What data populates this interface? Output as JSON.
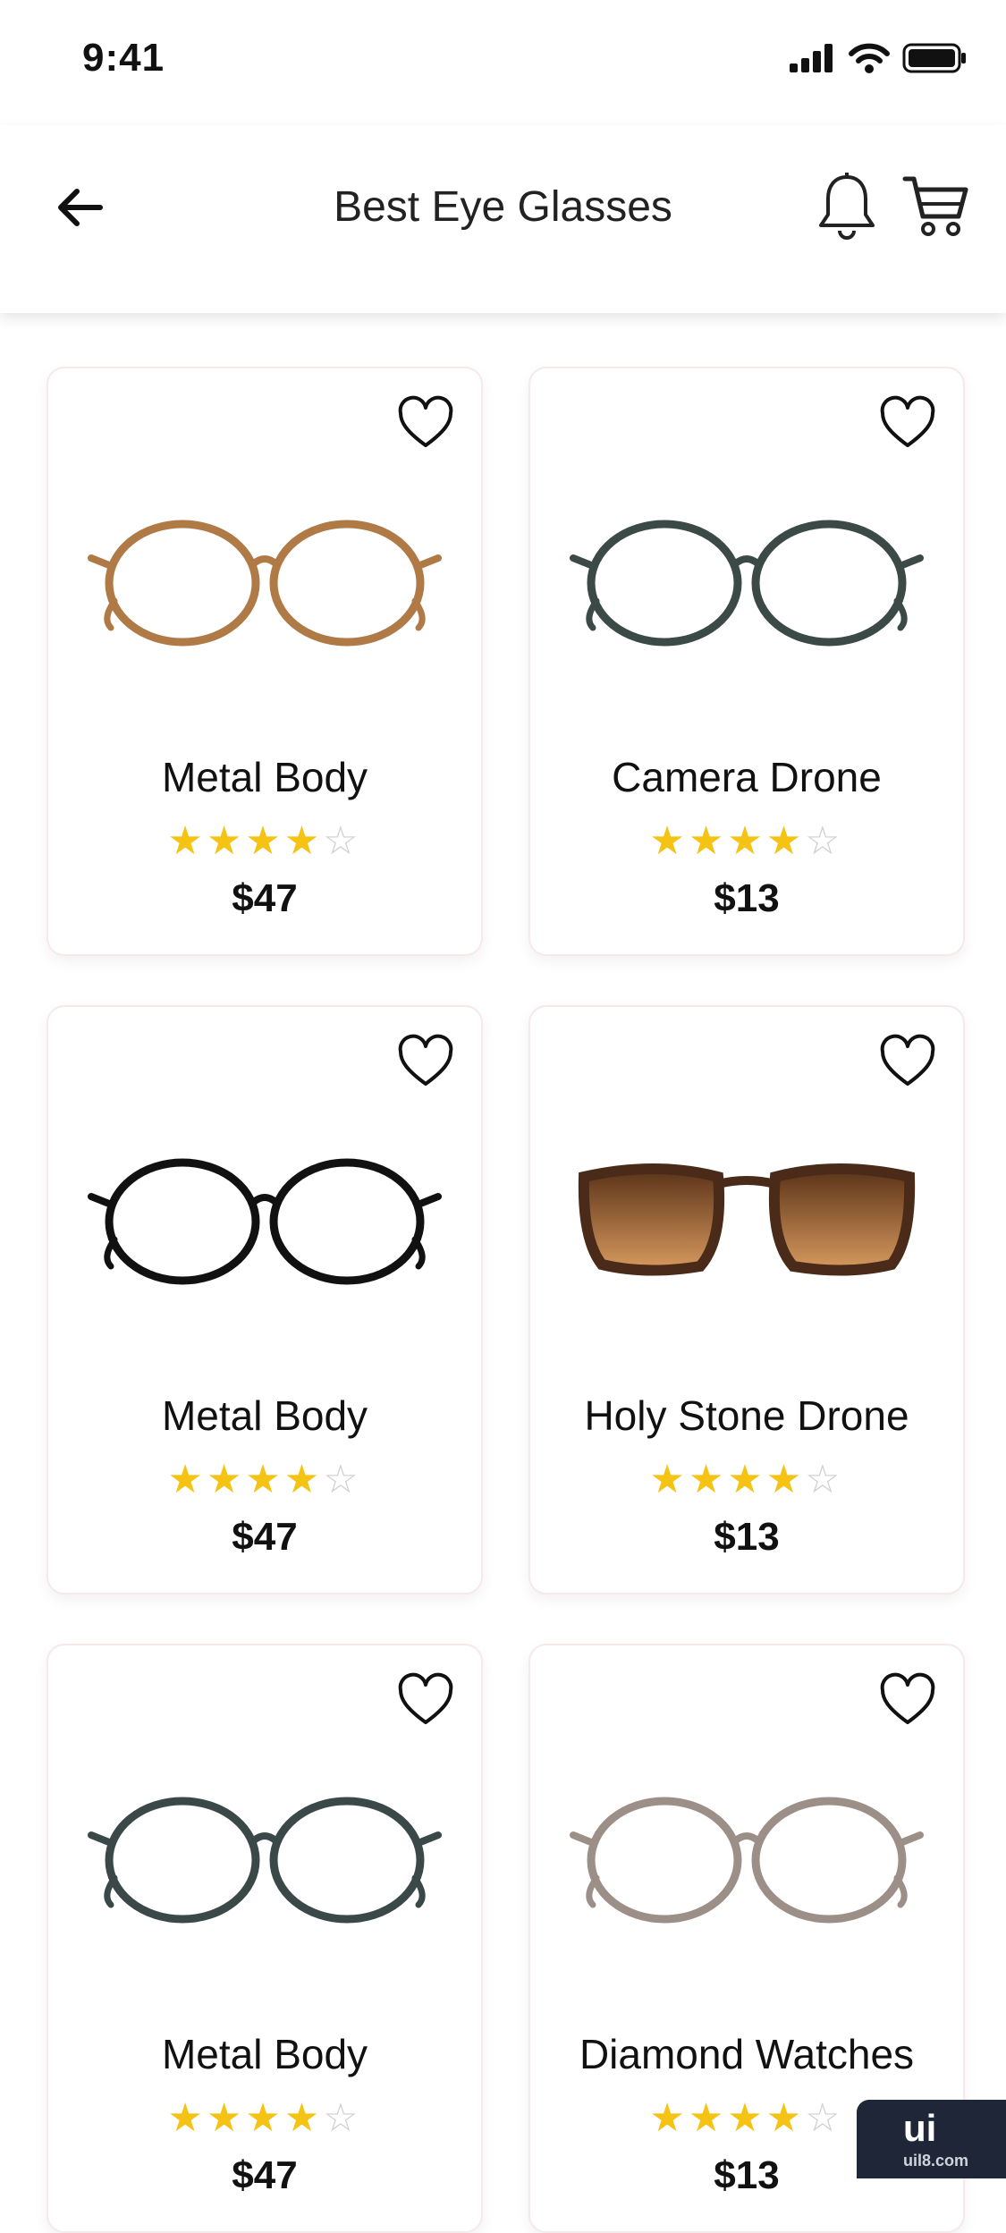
{
  "status_bar": {
    "time": "9:41"
  },
  "header": {
    "title": "Best Eye Glasses"
  },
  "products": [
    {
      "name": "Metal Body",
      "rating": 4,
      "max_rating": 5,
      "price": "$47",
      "frame_color": "#b07a47",
      "lens_style": "clear"
    },
    {
      "name": "Camera Drone",
      "rating": 4,
      "max_rating": 5,
      "price": "$13",
      "frame_color": "#3b4a47",
      "lens_style": "clear"
    },
    {
      "name": "Metal Body",
      "rating": 4,
      "max_rating": 5,
      "price": "$47",
      "frame_color": "#111111",
      "lens_style": "clear"
    },
    {
      "name": "Holy Stone Drone",
      "rating": 4,
      "max_rating": 5,
      "price": "$13",
      "frame_color": "#4a2a18",
      "lens_style": "tinted"
    },
    {
      "name": "Metal Body",
      "rating": 4,
      "max_rating": 5,
      "price": "$47",
      "frame_color": "#3a4947",
      "lens_style": "clear"
    },
    {
      "name": "Diamond Watches",
      "rating": 4,
      "max_rating": 5,
      "price": "$13",
      "frame_color": "#9c8f88",
      "lens_style": "clear"
    }
  ],
  "colors": {
    "star": "#f5c313",
    "star_empty": "#cfcfcf",
    "card_border": "#f6e9ea"
  },
  "watermark": {
    "main": "ui",
    "sub": "uil8.com"
  }
}
